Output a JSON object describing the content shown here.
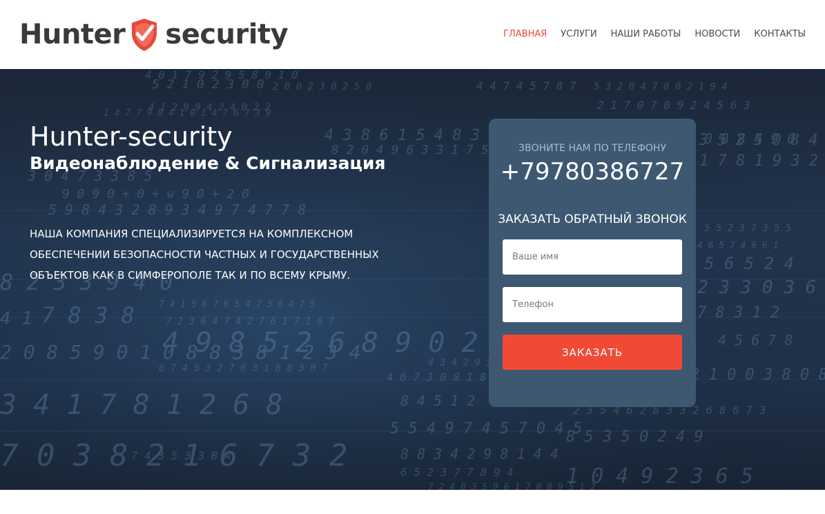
{
  "brand": {
    "name_left": "Hunter",
    "name_right": "security",
    "shield_icon": "shield-check-icon",
    "colors": {
      "shield": "#e64a3b",
      "text": "#3a3a3a"
    }
  },
  "nav": {
    "items": [
      {
        "label": "ГЛАВНАЯ",
        "active": true
      },
      {
        "label": "УСЛУГИ",
        "active": false
      },
      {
        "label": "НАШИ РАБОТЫ",
        "active": false
      },
      {
        "label": "НОВОСТИ",
        "active": false
      },
      {
        "label": "КОНТАКТЫ",
        "active": false
      }
    ],
    "active_color": "#e64a3b"
  },
  "hero": {
    "title": "Hunter-security",
    "subtitle": "Видеонаблюдение & Сигнализация",
    "description": "Наша компания специализируется на комплексном обеспечении безопасности частных и государственных объектов как в Симферополе так и по всему Крыму."
  },
  "callback_card": {
    "caption": "Звоните нам по телефону",
    "phone": "+79780386727",
    "form_title": "Заказать обратный звонок",
    "name_placeholder": "Ваше имя",
    "name_value": "",
    "phone_placeholder": "Телефон",
    "phone_value": "",
    "submit_label": "Заказать",
    "colors": {
      "card": "#3d5870",
      "button": "#f04a37"
    }
  }
}
